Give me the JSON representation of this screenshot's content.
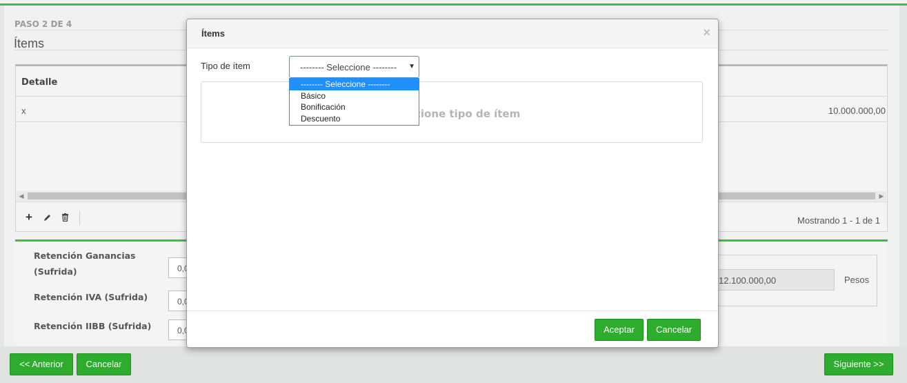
{
  "wizard": {
    "step": "PASO 2 DE 4",
    "title": "Ítems"
  },
  "grid": {
    "column_detail": "Detalle",
    "rows": [
      {
        "detail": "x",
        "amount": "10.000.000,00"
      }
    ],
    "showing": "Mostrando 1 - 1 de 1"
  },
  "retentions": [
    {
      "label_line1": "Retención Ganancias",
      "label_line2": "(Sufrida)",
      "value": "0,0"
    },
    {
      "label_line1": "Retención IVA (Sufrida)",
      "value": "0,0"
    },
    {
      "label_line1": "Retención IIBB (Sufrida)",
      "value": "0,0"
    }
  ],
  "total": {
    "value": "12.100.000,00",
    "unit": "Pesos"
  },
  "footer": {
    "prev_label": "<< Anterior",
    "cancel_label": "Cancelar",
    "next_label": "Siguiente >>"
  },
  "modal": {
    "title": "Ítems",
    "close_glyph": "×",
    "field_label": "Tipo de ítem",
    "select_value": "-------- Seleccione --------",
    "options": [
      "-------- Seleccione --------",
      "Básico",
      "Bonificación",
      "Descuento"
    ],
    "selected_index": 0,
    "placeholder_visible_text": "cione tipo de ítem",
    "accept_label": "Aceptar",
    "cancel_label": "Cancelar"
  },
  "colors": {
    "accent_green": "#2eac2e",
    "select_focus": "#4a90d9",
    "option_highlight": "#1e90ff"
  }
}
